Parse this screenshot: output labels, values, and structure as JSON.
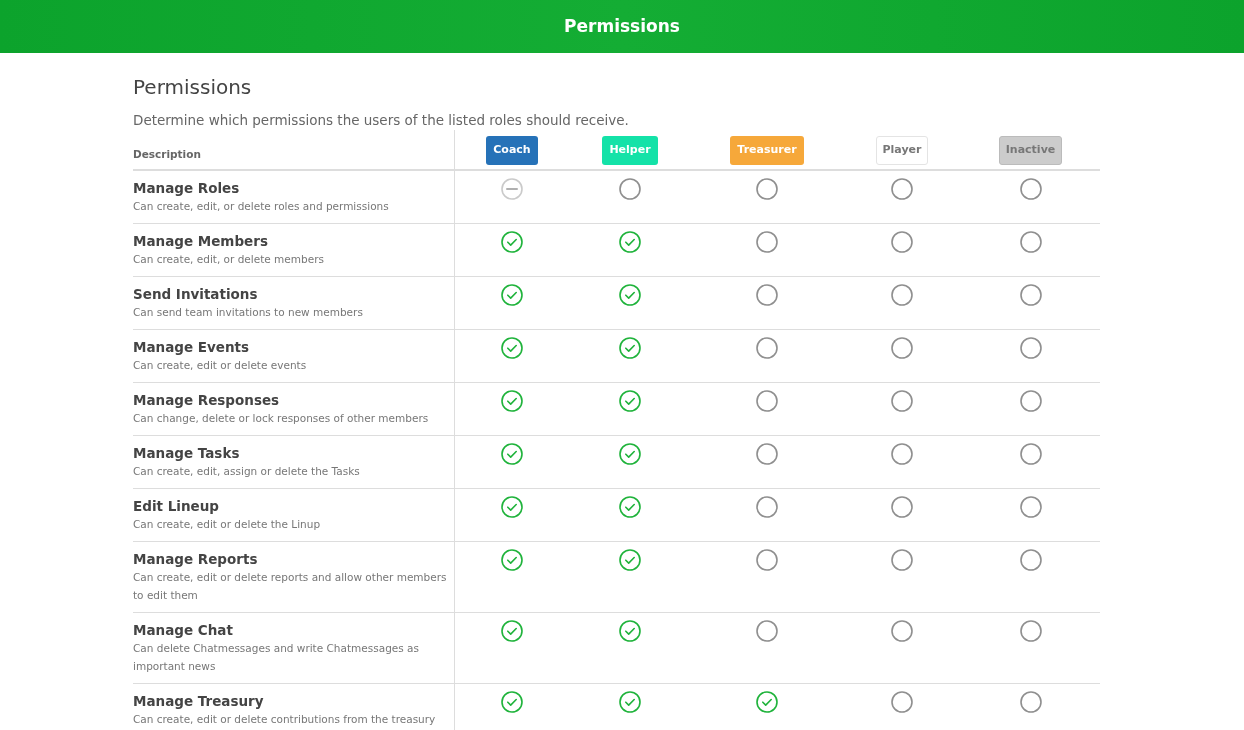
{
  "header": {
    "title": "Permissions"
  },
  "heading": "Permissions",
  "subtitle": "Determine which permissions the users of the listed roles should receive.",
  "table": {
    "description_column": "Description",
    "roles": [
      {
        "name": "Coach",
        "color": "#2672b8"
      },
      {
        "name": "Helper",
        "color": "#14e2a8"
      },
      {
        "name": "Treasurer",
        "color": "#f6a83a"
      },
      {
        "name": "Player",
        "color": "#ffffff"
      },
      {
        "name": "Inactive",
        "color": "#cccccc"
      }
    ],
    "rows": [
      {
        "title": "Manage Roles",
        "description": "Can create, edit, or delete roles and permissions",
        "cells": [
          {
            "checked": false,
            "disabled": true
          },
          {
            "checked": false,
            "disabled": false
          },
          {
            "checked": false,
            "disabled": false
          },
          {
            "checked": false,
            "disabled": false
          },
          {
            "checked": false,
            "disabled": false
          }
        ]
      },
      {
        "title": "Manage Members",
        "description": "Can create, edit, or delete members",
        "cells": [
          {
            "checked": true,
            "disabled": false
          },
          {
            "checked": true,
            "disabled": false
          },
          {
            "checked": false,
            "disabled": false
          },
          {
            "checked": false,
            "disabled": false
          },
          {
            "checked": false,
            "disabled": false
          }
        ]
      },
      {
        "title": "Send Invitations",
        "description": "Can send team invitations to new members",
        "cells": [
          {
            "checked": true,
            "disabled": false
          },
          {
            "checked": true,
            "disabled": false
          },
          {
            "checked": false,
            "disabled": false
          },
          {
            "checked": false,
            "disabled": false
          },
          {
            "checked": false,
            "disabled": false
          }
        ]
      },
      {
        "title": "Manage Events",
        "description": "Can create, edit or delete events",
        "cells": [
          {
            "checked": true,
            "disabled": false
          },
          {
            "checked": true,
            "disabled": false
          },
          {
            "checked": false,
            "disabled": false
          },
          {
            "checked": false,
            "disabled": false
          },
          {
            "checked": false,
            "disabled": false
          }
        ]
      },
      {
        "title": "Manage Responses",
        "description": "Can change, delete or lock responses of other members",
        "cells": [
          {
            "checked": true,
            "disabled": false
          },
          {
            "checked": true,
            "disabled": false
          },
          {
            "checked": false,
            "disabled": false
          },
          {
            "checked": false,
            "disabled": false
          },
          {
            "checked": false,
            "disabled": false
          }
        ]
      },
      {
        "title": "Manage Tasks",
        "description": "Can create, edit, assign or delete the Tasks",
        "cells": [
          {
            "checked": true,
            "disabled": false
          },
          {
            "checked": true,
            "disabled": false
          },
          {
            "checked": false,
            "disabled": false
          },
          {
            "checked": false,
            "disabled": false
          },
          {
            "checked": false,
            "disabled": false
          }
        ]
      },
      {
        "title": "Edit Lineup",
        "description": "Can create, edit or delete the Linup",
        "cells": [
          {
            "checked": true,
            "disabled": false
          },
          {
            "checked": true,
            "disabled": false
          },
          {
            "checked": false,
            "disabled": false
          },
          {
            "checked": false,
            "disabled": false
          },
          {
            "checked": false,
            "disabled": false
          }
        ]
      },
      {
        "title": "Manage Reports",
        "description": "Can create, edit or delete reports and allow other members to edit them",
        "cells": [
          {
            "checked": true,
            "disabled": false
          },
          {
            "checked": true,
            "disabled": false
          },
          {
            "checked": false,
            "disabled": false
          },
          {
            "checked": false,
            "disabled": false
          },
          {
            "checked": false,
            "disabled": false
          }
        ]
      },
      {
        "title": "Manage Chat",
        "description": "Can delete Chatmessages and write Chatmessages as important news",
        "cells": [
          {
            "checked": true,
            "disabled": false
          },
          {
            "checked": true,
            "disabled": false
          },
          {
            "checked": false,
            "disabled": false
          },
          {
            "checked": false,
            "disabled": false
          },
          {
            "checked": false,
            "disabled": false
          }
        ]
      },
      {
        "title": "Manage Treasury",
        "description": "Can create, edit or delete contributions from the treasury",
        "cells": [
          {
            "checked": true,
            "disabled": false
          },
          {
            "checked": true,
            "disabled": false
          },
          {
            "checked": true,
            "disabled": false
          },
          {
            "checked": false,
            "disabled": false
          },
          {
            "checked": false,
            "disabled": false
          }
        ]
      }
    ]
  }
}
